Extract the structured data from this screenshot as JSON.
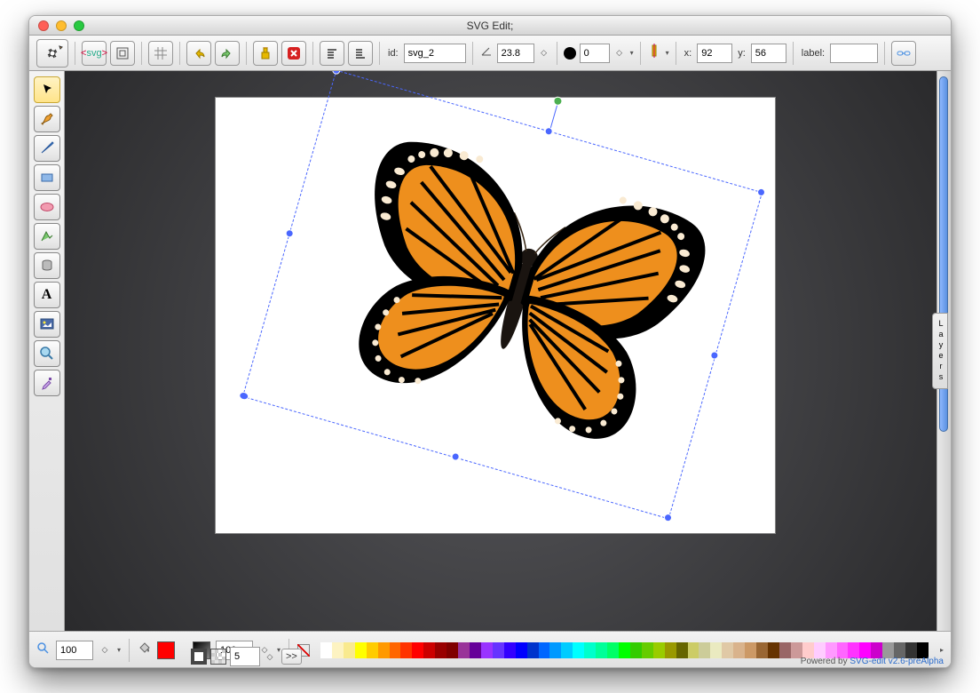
{
  "window_title": "SVG Edit;",
  "toolbar": {
    "id_label": "id:",
    "id_value": "svg_2",
    "angle_value": "23.8",
    "opacity_value": "0",
    "x_label": "x:",
    "x_value": "92",
    "y_label": "y:",
    "y_value": "56",
    "label_label": "label:"
  },
  "bottom": {
    "zoom_value": "100",
    "opacity_value": "100",
    "stroke_width": "5",
    "stroke_more": ">>",
    "powered": "Powered by ",
    "link": "SVG-edit v2.6-preAlpha"
  },
  "layers_label": "Layers",
  "palette_colors": [
    "#ffffff",
    "#fdf3c2",
    "#f9ea8f",
    "#ffff00",
    "#ffcc00",
    "#ff9900",
    "#ff6600",
    "#ff3300",
    "#ff0000",
    "#cc0000",
    "#990000",
    "#800000",
    "#993399",
    "#660099",
    "#9933ff",
    "#6633ff",
    "#3300ff",
    "#0000ff",
    "#0033cc",
    "#0066ff",
    "#0099ff",
    "#00ccff",
    "#00ffff",
    "#00ffcc",
    "#00ff99",
    "#00ff66",
    "#00ff00",
    "#33cc00",
    "#66cc00",
    "#99cc00",
    "#999900",
    "#666600",
    "#cccc66",
    "#cccc99",
    "#eaeac0",
    "#e0c9a6",
    "#d9b38c",
    "#cc9966",
    "#996633",
    "#663300",
    "#996666",
    "#cc9999",
    "#ffcccc",
    "#ffccff",
    "#ff99ff",
    "#ff66ff",
    "#ff33ff",
    "#ff00ff",
    "#cc00cc",
    "#999999",
    "#666666",
    "#333333",
    "#000000"
  ]
}
